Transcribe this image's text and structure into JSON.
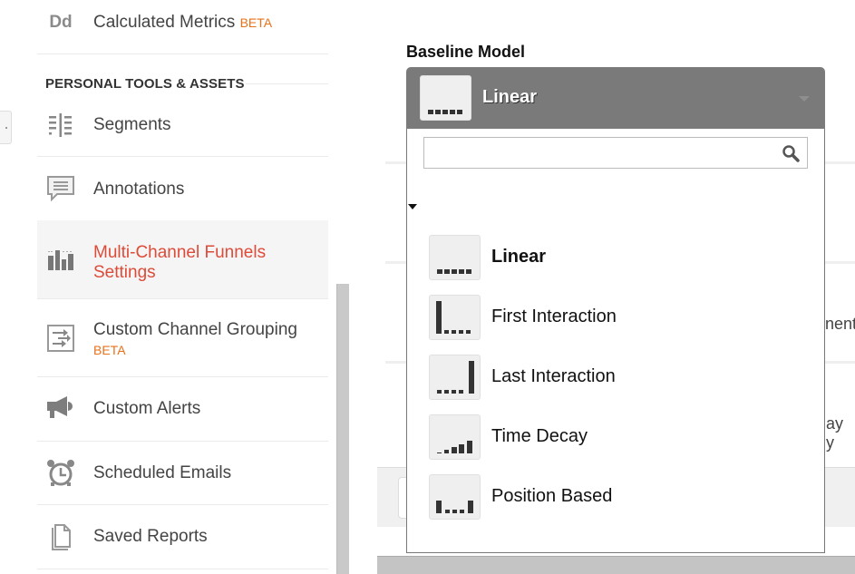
{
  "sidebar": {
    "items_top": [
      {
        "label": "Calculated Metrics",
        "badge": "BETA",
        "icon": "dd-icon"
      }
    ],
    "section_title": "PERSONAL TOOLS & ASSETS",
    "items": [
      {
        "label": "Segments",
        "icon": "segments-icon"
      },
      {
        "label": "Annotations",
        "icon": "annotations-icon"
      },
      {
        "label": "Multi-Channel Funnels",
        "label_line2": "Settings",
        "icon": "mcf-settings-icon",
        "active": true
      },
      {
        "label": "Custom Channel Grouping",
        "badge": "BETA",
        "icon": "channel-grouping-icon"
      },
      {
        "label": "Custom Alerts",
        "icon": "megaphone-icon"
      },
      {
        "label": "Scheduled Emails",
        "icon": "alarm-clock-icon"
      },
      {
        "label": "Saved Reports",
        "icon": "document-icon"
      }
    ],
    "dd_glyph": "Dd"
  },
  "background": {
    "partial_text_1": "nent",
    "partial_text_2": "ay y"
  },
  "baseline_model": {
    "label": "Baseline Model",
    "selected": "Linear",
    "search_placeholder": "",
    "search_value": "",
    "options": [
      {
        "label": "Linear",
        "icon": "linear-model-icon",
        "selected": true
      },
      {
        "label": "First Interaction",
        "icon": "first-interaction-model-icon"
      },
      {
        "label": "Last Interaction",
        "icon": "last-interaction-model-icon"
      },
      {
        "label": "Time Decay",
        "icon": "time-decay-model-icon"
      },
      {
        "label": "Position Based",
        "icon": "position-based-model-icon"
      }
    ]
  },
  "colors": {
    "active_text": "#dd4b39",
    "beta": "#e8711a",
    "select_head": "#7a7a7a"
  }
}
